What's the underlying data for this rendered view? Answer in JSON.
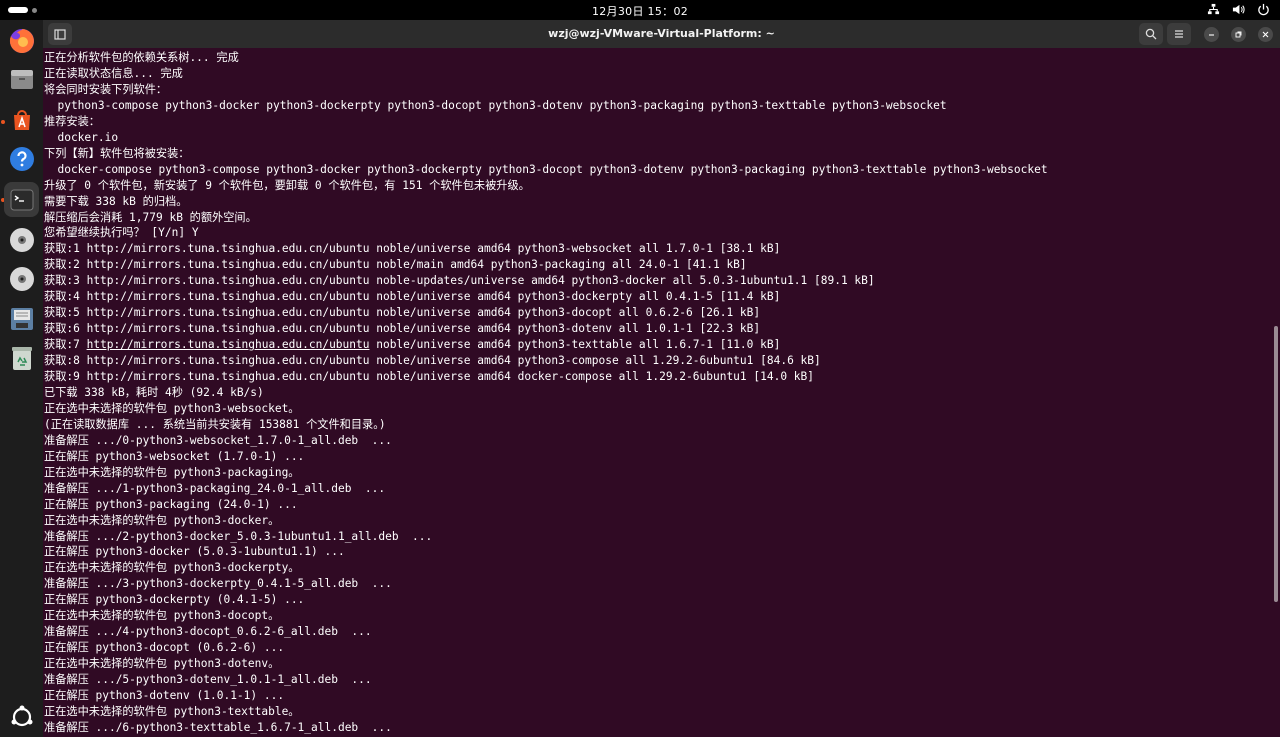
{
  "topbar": {
    "clock": "12月30日 15：02",
    "tray_icons": [
      "network-icon",
      "volume-icon",
      "power-icon"
    ]
  },
  "dock": {
    "items": [
      {
        "name": "firefox-icon",
        "running": false
      },
      {
        "name": "files-icon",
        "running": false
      },
      {
        "name": "app-center-icon",
        "running": true
      },
      {
        "name": "help-icon",
        "running": false
      },
      {
        "name": "terminal-icon",
        "running": true,
        "active": true
      },
      {
        "name": "disc-icon",
        "running": false
      },
      {
        "name": "disc-icon",
        "running": false
      },
      {
        "name": "save-disk-icon",
        "running": false
      },
      {
        "name": "trash-icon",
        "running": false
      },
      {
        "name": "show-apps-icon",
        "running": false
      }
    ]
  },
  "window": {
    "title": "wzj@wzj-VMware-Virtual-Platform: ~",
    "background": "#300a24"
  },
  "terminal": {
    "lines": [
      "正在分析软件包的依赖关系树... 完成",
      "正在读取状态信息... 完成",
      "将会同时安装下列软件：",
      "  python3-compose python3-docker python3-dockerpty python3-docopt python3-dotenv python3-packaging python3-texttable python3-websocket",
      "推荐安装：",
      "  docker.io",
      "下列【新】软件包将被安装：",
      "  docker-compose python3-compose python3-docker python3-dockerpty python3-docopt python3-dotenv python3-packaging python3-texttable python3-websocket",
      "升级了 0 个软件包，新安装了 9 个软件包，要卸载 0 个软件包，有 151 个软件包未被升级。",
      "需要下载 338 kB 的归档。",
      "解压缩后会消耗 1,779 kB 的额外空间。",
      "您希望继续执行吗？ [Y/n] Y",
      "获取:1 http://mirrors.tuna.tsinghua.edu.cn/ubuntu noble/universe amd64 python3-websocket all 1.7.0-1 [38.1 kB]",
      "获取:2 http://mirrors.tuna.tsinghua.edu.cn/ubuntu noble/main amd64 python3-packaging all 24.0-1 [41.1 kB]",
      "获取:3 http://mirrors.tuna.tsinghua.edu.cn/ubuntu noble-updates/universe amd64 python3-docker all 5.0.3-1ubuntu1.1 [89.1 kB]",
      "获取:4 http://mirrors.tuna.tsinghua.edu.cn/ubuntu noble/universe amd64 python3-dockerpty all 0.4.1-5 [11.4 kB]",
      "获取:5 http://mirrors.tuna.tsinghua.edu.cn/ubuntu noble/universe amd64 python3-docopt all 0.6.2-6 [26.1 kB]",
      "获取:6 http://mirrors.tuna.tsinghua.edu.cn/ubuntu noble/universe amd64 python3-dotenv all 1.0.1-1 [22.3 kB]",
      "获取:7 http://mirrors.tuna.tsinghua.edu.cn/ubuntu noble/universe amd64 python3-texttable all 1.6.7-1 [11.0 kB]",
      "获取:8 http://mirrors.tuna.tsinghua.edu.cn/ubuntu noble/universe amd64 python3-compose all 1.29.2-6ubuntu1 [84.6 kB]",
      "获取:9 http://mirrors.tuna.tsinghua.edu.cn/ubuntu noble/universe amd64 docker-compose all 1.29.2-6ubuntu1 [14.0 kB]",
      "已下载 338 kB，耗时 4秒 (92.4 kB/s)",
      "正在选中未选择的软件包 python3-websocket。",
      "(正在读取数据库 ... 系统当前共安装有 153881 个文件和目录。)",
      "准备解压 .../0-python3-websocket_1.7.0-1_all.deb  ...",
      "正在解压 python3-websocket (1.7.0-1) ...",
      "正在选中未选择的软件包 python3-packaging。",
      "准备解压 .../1-python3-packaging_24.0-1_all.deb  ...",
      "正在解压 python3-packaging (24.0-1) ...",
      "正在选中未选择的软件包 python3-docker。",
      "准备解压 .../2-python3-docker_5.0.3-1ubuntu1.1_all.deb  ...",
      "正在解压 python3-docker (5.0.3-1ubuntu1.1) ...",
      "正在选中未选择的软件包 python3-dockerpty。",
      "准备解压 .../3-python3-dockerpty_0.4.1-5_all.deb  ...",
      "正在解压 python3-dockerpty (0.4.1-5) ...",
      "正在选中未选择的软件包 python3-docopt。",
      "准备解压 .../4-python3-docopt_0.6.2-6_all.deb  ...",
      "正在解压 python3-docopt (0.6.2-6) ...",
      "正在选中未选择的软件包 python3-dotenv。",
      "准备解压 .../5-python3-dotenv_1.0.1-1_all.deb  ...",
      "正在解压 python3-dotenv (1.0.1-1) ...",
      "正在选中未选择的软件包 python3-texttable。",
      "准备解压 .../6-python3-texttable_1.6.7-1_all.deb  ..."
    ],
    "hovered_link": {
      "line_index": 18,
      "prefix": "获取:7 ",
      "url": "http://mirrors.tuna.tsinghua.edu.cn/ubuntu",
      "suffix": " noble/universe amd64 python3-texttable all 1.6.7-1 [11.0 kB]"
    }
  }
}
